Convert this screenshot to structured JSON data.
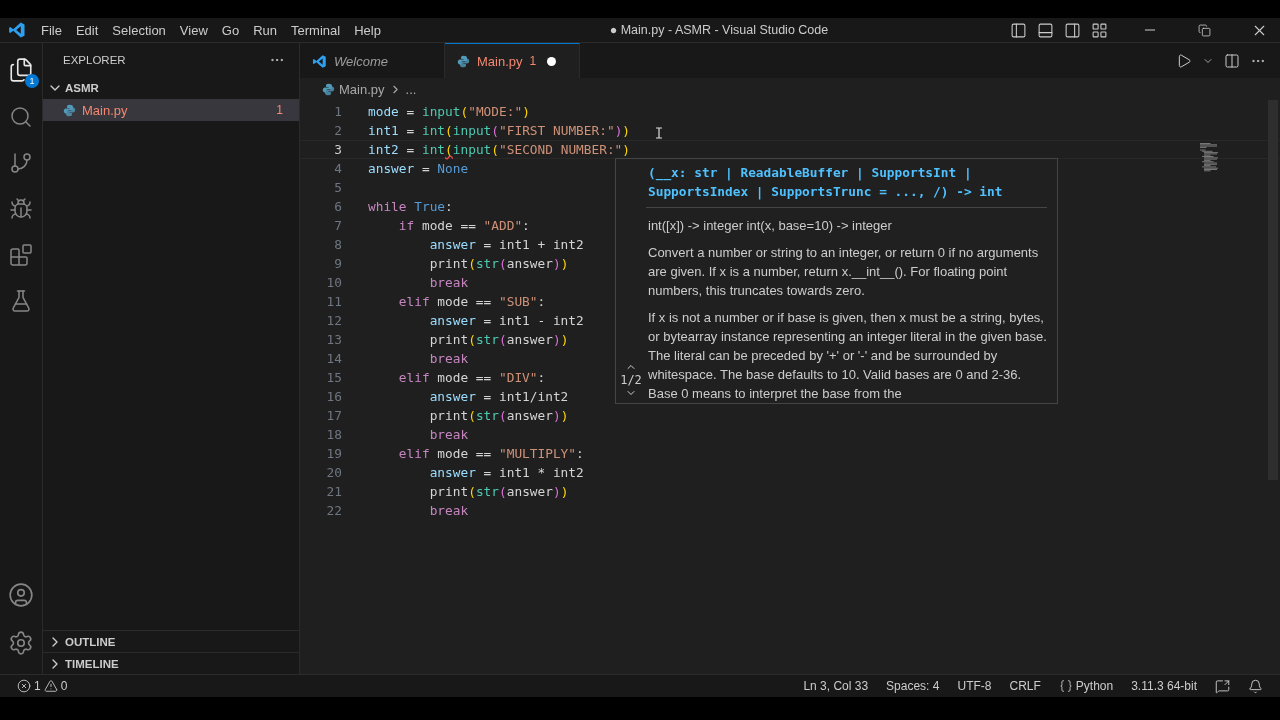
{
  "window": {
    "title": "● Main.py - ASMR - Visual Studio Code"
  },
  "menu": [
    "File",
    "Edit",
    "Selection",
    "View",
    "Go",
    "Run",
    "Terminal",
    "Help"
  ],
  "activity_bar": {
    "explorer_badge": "1"
  },
  "sidebar": {
    "title": "EXPLORER",
    "folder": {
      "label": "ASMR",
      "expanded": true,
      "children": [
        {
          "label": "Main.py",
          "badge": "1",
          "selected": true
        }
      ]
    },
    "sections": [
      {
        "label": "OUTLINE",
        "expanded": false
      },
      {
        "label": "TIMELINE",
        "expanded": false
      }
    ]
  },
  "tabs": [
    {
      "label": "Welcome",
      "kind": "welcome",
      "selected": false
    },
    {
      "label": "Main.py",
      "kind": "python",
      "selected": true,
      "problems": "1",
      "dirty": true
    }
  ],
  "breadcrumb": [
    "Main.py",
    "..."
  ],
  "editor": {
    "lines": [
      {
        "number": "1",
        "current": false,
        "tokens": [
          {
            "text": "mode",
            "kind": "variable"
          },
          {
            "text": " = ",
            "kind": "plain"
          },
          {
            "text": "input",
            "kind": "builtin"
          },
          {
            "text": "(",
            "kind": "bracket1"
          },
          {
            "text": "\"MODE:\"",
            "kind": "string"
          },
          {
            "text": ")",
            "kind": "bracket1"
          }
        ]
      },
      {
        "number": "2",
        "current": false,
        "tokens": [
          {
            "text": "int1",
            "kind": "variable"
          },
          {
            "text": " = ",
            "kind": "plain"
          },
          {
            "text": "int",
            "kind": "builtin"
          },
          {
            "text": "(",
            "kind": "bracket1"
          },
          {
            "text": "input",
            "kind": "builtin"
          },
          {
            "text": "(",
            "kind": "bracket2"
          },
          {
            "text": "\"FIRST NUMBER:\"",
            "kind": "string"
          },
          {
            "text": ")",
            "kind": "bracket2"
          },
          {
            "text": ")",
            "kind": "bracket1"
          }
        ]
      },
      {
        "number": "3",
        "current": true,
        "tokens": [
          {
            "text": "int2",
            "kind": "variable"
          },
          {
            "text": " = ",
            "kind": "plain"
          },
          {
            "text": "int",
            "kind": "builtin"
          },
          {
            "text": "(",
            "kind": "error"
          },
          {
            "text": "input",
            "kind": "builtin"
          },
          {
            "text": "(",
            "kind": "bracket1"
          },
          {
            "text": "\"SECOND NUMBER:\"",
            "kind": "string"
          },
          {
            "text": ")",
            "kind": "bracket1"
          }
        ]
      },
      {
        "number": "4",
        "current": false,
        "tokens": [
          {
            "text": "answer",
            "kind": "variable"
          },
          {
            "text": " = ",
            "kind": "plain"
          },
          {
            "text": "None",
            "kind": "constant"
          }
        ]
      },
      {
        "number": "5",
        "current": false
      },
      {
        "number": "6",
        "current": false,
        "tokens": [
          {
            "text": "while",
            "kind": "keyword"
          },
          {
            "text": " True",
            "kind": "constant"
          },
          {
            "text": ":",
            "kind": "plain"
          }
        ]
      },
      {
        "number": "7",
        "current": false,
        "tokens": [
          {
            "text": "    if",
            "kind": "keyword"
          },
          {
            "text": " mode == ",
            "kind": "plain"
          },
          {
            "text": "\"ADD\"",
            "kind": "string"
          },
          {
            "text": ":",
            "kind": "plain"
          }
        ]
      },
      {
        "number": "8",
        "current": false,
        "tokens": [
          {
            "text": "        answer",
            "kind": "variable"
          },
          {
            "text": " = int1 + int2",
            "kind": "plain"
          }
        ]
      },
      {
        "number": "9",
        "current": false,
        "tokens": [
          {
            "text": "        print",
            "kind": "plain"
          },
          {
            "text": "(",
            "kind": "bracket1"
          },
          {
            "text": "str",
            "kind": "builtin"
          },
          {
            "text": "(",
            "kind": "bracket2"
          },
          {
            "text": "answer",
            "kind": "plain"
          },
          {
            "text": ")",
            "kind": "bracket2"
          },
          {
            "text": ")",
            "kind": "bracket1"
          }
        ]
      },
      {
        "number": "10",
        "current": false,
        "tokens": [
          {
            "text": "        break",
            "kind": "keyword"
          }
        ]
      },
      {
        "number": "11",
        "current": false,
        "tokens": [
          {
            "text": "    elif",
            "kind": "keyword"
          },
          {
            "text": " mode == ",
            "kind": "plain"
          },
          {
            "text": "\"SUB\"",
            "kind": "string"
          },
          {
            "text": ":",
            "kind": "plain"
          }
        ]
      },
      {
        "number": "12",
        "current": false,
        "tokens": [
          {
            "text": "        answer",
            "kind": "variable"
          },
          {
            "text": " = int1 - int2",
            "kind": "plain"
          }
        ]
      },
      {
        "number": "13",
        "current": false,
        "tokens": [
          {
            "text": "        print",
            "kind": "plain"
          },
          {
            "text": "(",
            "kind": "bracket1"
          },
          {
            "text": "str",
            "kind": "builtin"
          },
          {
            "text": "(",
            "kind": "bracket2"
          },
          {
            "text": "answer",
            "kind": "plain"
          },
          {
            "text": ")",
            "kind": "bracket2"
          },
          {
            "text": ")",
            "kind": "bracket1"
          }
        ]
      },
      {
        "number": "14",
        "current": false,
        "tokens": [
          {
            "text": "        break",
            "kind": "keyword"
          }
        ]
      },
      {
        "number": "15",
        "current": false,
        "tokens": [
          {
            "text": "    elif",
            "kind": "keyword"
          },
          {
            "text": " mode == ",
            "kind": "plain"
          },
          {
            "text": "\"DIV\"",
            "kind": "string"
          },
          {
            "text": ":",
            "kind": "plain"
          }
        ]
      },
      {
        "number": "16",
        "current": false,
        "tokens": [
          {
            "text": "        answer",
            "kind": "variable"
          },
          {
            "text": " = int1/int2",
            "kind": "plain"
          }
        ]
      },
      {
        "number": "17",
        "current": false,
        "tokens": [
          {
            "text": "        print",
            "kind": "plain"
          },
          {
            "text": "(",
            "kind": "bracket1"
          },
          {
            "text": "str",
            "kind": "builtin"
          },
          {
            "text": "(",
            "kind": "bracket2"
          },
          {
            "text": "answer",
            "kind": "plain"
          },
          {
            "text": ")",
            "kind": "bracket2"
          },
          {
            "text": ")",
            "kind": "bracket1"
          }
        ]
      },
      {
        "number": "18",
        "current": false,
        "tokens": [
          {
            "text": "        break",
            "kind": "keyword"
          }
        ]
      },
      {
        "number": "19",
        "current": false,
        "tokens": [
          {
            "text": "    elif",
            "kind": "keyword"
          },
          {
            "text": " mode == ",
            "kind": "plain"
          },
          {
            "text": "\"MULTIPLY\"",
            "kind": "string"
          },
          {
            "text": ":",
            "kind": "plain"
          }
        ]
      },
      {
        "number": "20",
        "current": false,
        "tokens": [
          {
            "text": "        answer",
            "kind": "variable"
          },
          {
            "text": " = int1 * int2",
            "kind": "plain"
          }
        ]
      },
      {
        "number": "21",
        "current": false,
        "tokens": [
          {
            "text": "        print",
            "kind": "plain"
          },
          {
            "text": "(",
            "kind": "bracket1"
          },
          {
            "text": "str",
            "kind": "builtin"
          },
          {
            "text": "(",
            "kind": "bracket2"
          },
          {
            "text": "answer",
            "kind": "plain"
          },
          {
            "text": ")",
            "kind": "bracket2"
          },
          {
            "text": ")",
            "kind": "bracket1"
          }
        ]
      },
      {
        "number": "22",
        "current": false,
        "tokens": [
          {
            "text": "        break",
            "kind": "keyword"
          }
        ]
      }
    ]
  },
  "hover": {
    "signature": "(__x: str | ReadableBuffer | SupportsInt | SupportsIndex | SupportsTrunc = ..., /) -> int",
    "paragraphs": [
      "int([x]) -> integer int(x, base=10) -> integer",
      "Convert a number or string to an integer, or return 0 if no arguments are given. If x is a number, return x.__int__(). For floating point numbers, this truncates towards zero.",
      "If x is not a number or if base is given, then x must be a string, bytes, or bytearray instance representing an integer literal in the given base. The literal can be preceded by '+' or '-' and be surrounded by whitespace. The base defaults to 10. Valid bases are 0 and 2-36. Base 0 means to interpret the base from the"
    ],
    "pager": "1/2"
  },
  "status_bar": {
    "errors": "1",
    "warnings": "0",
    "items": [
      "Ln 3, Col 33",
      "Spaces: 4",
      "UTF-8",
      "CRLF"
    ],
    "language": "Python",
    "interpreter": "3.11.3 64-bit"
  }
}
